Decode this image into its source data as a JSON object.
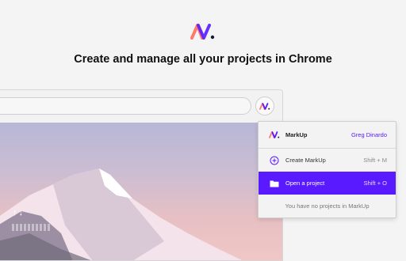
{
  "brand": {
    "accent": "#5a1aff",
    "logo_colors": [
      "#ff7a6b",
      "#5a1aff",
      "#1a1a2e"
    ]
  },
  "headline": "Create and manage all your projects in Chrome",
  "popup": {
    "app_name": "MarkUp",
    "user_name": "Greg Dinardo",
    "items": [
      {
        "label": "Create MarkUp",
        "shortcut": "Shift + M",
        "icon": "plus-circle-icon"
      },
      {
        "label": "Open a project",
        "shortcut": "Shift + O",
        "icon": "folder-icon"
      }
    ],
    "empty_message": "You have no projects in MarkUp"
  },
  "photo": {
    "arrows": "↑↓"
  }
}
